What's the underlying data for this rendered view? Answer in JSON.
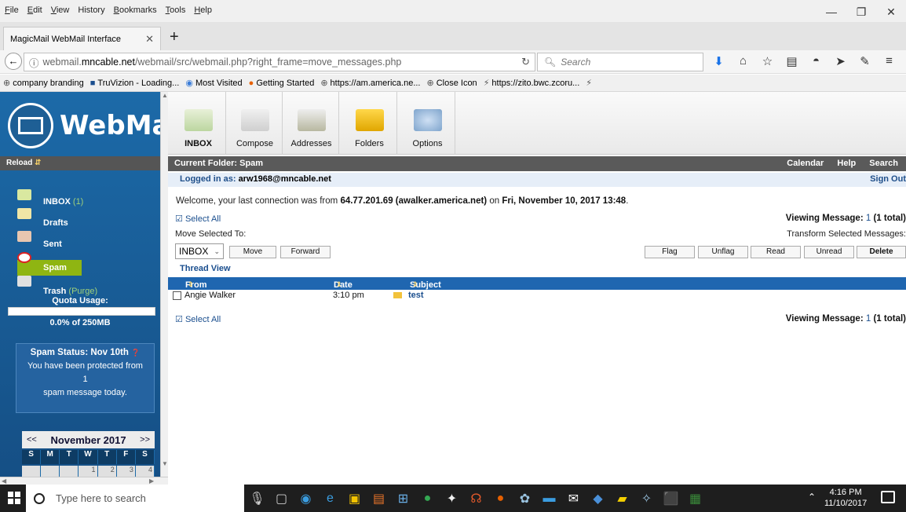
{
  "menubar": {
    "items": [
      {
        "u": "F",
        "rest": "ile"
      },
      {
        "u": "E",
        "rest": "dit"
      },
      {
        "u": "V",
        "rest": "iew"
      },
      {
        "u": "",
        "rest": "History"
      },
      {
        "u": "B",
        "rest": "ookmarks"
      },
      {
        "u": "T",
        "rest": "ools"
      },
      {
        "u": "H",
        "rest": "elp"
      }
    ]
  },
  "window": {
    "minimize": "—",
    "restore": "❐",
    "close": "✕"
  },
  "tab": {
    "title": "MagicMail WebMail Interface",
    "close": "✕",
    "new_tab": "+"
  },
  "nav": {
    "url_prefix": "webmail.",
    "url_host": "mncable.net",
    "url_path": "/webmail/src/webmail.php?right_frame=move_messages.php",
    "search_placeholder": "Search"
  },
  "bookmarks": [
    "company branding",
    "TruVizion - Loading...",
    "Most Visited",
    "Getting Started",
    "https://am.america.ne...",
    "Close Icon",
    "https://zito.bwc.zcoru..."
  ],
  "sidebar": {
    "logo_text": "WebMail",
    "reload": "Reload",
    "folders": {
      "inbox": "INBOX",
      "inbox_count": "(1)",
      "drafts": "Drafts",
      "sent": "Sent",
      "spam": "Spam",
      "trash": "Trash",
      "purge": "(Purge)"
    },
    "quota_label": "Quota Usage:",
    "quota_text": "0.0% of 250MB",
    "quota_fraction": 0.0,
    "spam_status": {
      "title": "Spam Status: Nov 10th",
      "line1": "You have been protected from",
      "count": "1",
      "line2": "spam message today."
    },
    "calendar": {
      "prev": "<<",
      "title": "November 2017",
      "next": ">>",
      "days": [
        "S",
        "M",
        "T",
        "W",
        "T",
        "F",
        "S"
      ],
      "first_row": [
        "",
        "",
        "",
        "1",
        "2",
        "3",
        "4"
      ]
    }
  },
  "toolbar": {
    "inbox": "INBOX",
    "compose": "Compose",
    "addresses": "Addresses",
    "folders": "Folders",
    "options": "Options"
  },
  "main": {
    "current_folder_label": "Current Folder:",
    "current_folder": "Spam",
    "links": {
      "calendar": "Calendar",
      "help": "Help",
      "search": "Search"
    },
    "logged_in_label": "Logged in as:",
    "logged_in_user": "arw1968@mncable.net",
    "sign_out": "Sign Out",
    "welcome_prefix": "Welcome, your last connection was from ",
    "welcome_ip": "64.77.201.69 (awalker.america.net)",
    "welcome_mid": " on ",
    "welcome_date": "Fri, November 10, 2017 13:48",
    "welcome_end": ".",
    "select_all": "Select All",
    "viewing_label": "Viewing Message:",
    "viewing_num": "1",
    "viewing_total": "(1 total)",
    "move_selected_to": "Move Selected To:",
    "transform_selected": "Transform Selected Messages:",
    "move_select_value": "INBOX",
    "buttons": {
      "move": "Move",
      "forward": "Forward",
      "flag": "Flag",
      "unflag": "Unflag",
      "read": "Read",
      "unread": "Unread",
      "delete": "Delete"
    },
    "thread_view": "Thread View",
    "columns": {
      "from": "From",
      "date": "Date",
      "subject": "Subject"
    },
    "messages": [
      {
        "from": "Angie Walker",
        "date": "3:10 pm",
        "subject": "test"
      }
    ]
  },
  "taskbar": {
    "search_placeholder": "Type here to search",
    "time": "4:16 PM",
    "date": "11/10/2017"
  }
}
